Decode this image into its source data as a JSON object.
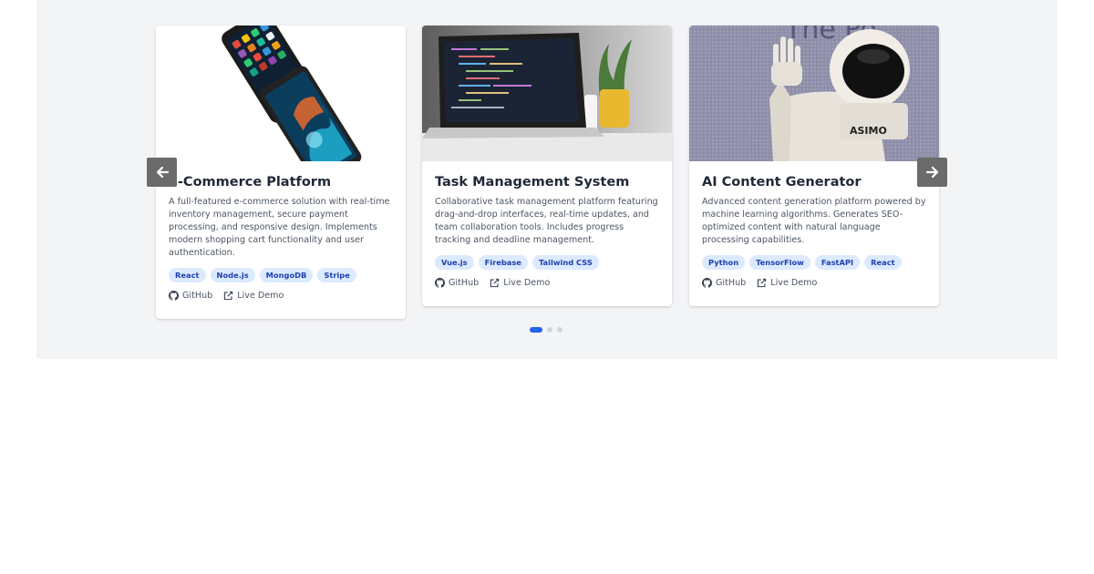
{
  "colors": {
    "section_bg": "#f3f4f6",
    "tag_bg": "#dbeafe",
    "tag_text": "#1e40af",
    "dot_active": "#2563eb",
    "dot": "#d1d5db"
  },
  "carousel": {
    "prev_icon": "arrow-left-icon",
    "next_icon": "arrow-right-icon",
    "active_index": 0,
    "dot_count": 3
  },
  "projects": [
    {
      "title": "E-Commerce Platform",
      "image": "smartphones-photo",
      "description": "A full-featured e-commerce solution with real-time inventory management, secure payment processing, and responsive design. Implements modern shopping cart functionality and user authentication.",
      "tags": [
        "React",
        "Node.js",
        "MongoDB",
        "Stripe"
      ],
      "github_label": "GitHub",
      "demo_label": "Live Demo"
    },
    {
      "title": "Task Management System",
      "image": "laptop-code-photo",
      "description": "Collaborative task management platform featuring drag-and-drop interfaces, real-time updates, and team collaboration tools. Includes progress tracking and deadline management.",
      "tags": [
        "Vue.js",
        "Firebase",
        "Tailwind CSS"
      ],
      "github_label": "GitHub",
      "demo_label": "Live Demo"
    },
    {
      "title": "AI Content Generator",
      "image": "asimo-robot-photo",
      "image_text": "ASIMO",
      "description": "Advanced content generation platform powered by machine learning algorithms. Generates SEO-optimized content with natural language processing capabilities.",
      "tags": [
        "Python",
        "TensorFlow",
        "FastAPI",
        "React"
      ],
      "github_label": "GitHub",
      "demo_label": "Live Demo"
    }
  ]
}
